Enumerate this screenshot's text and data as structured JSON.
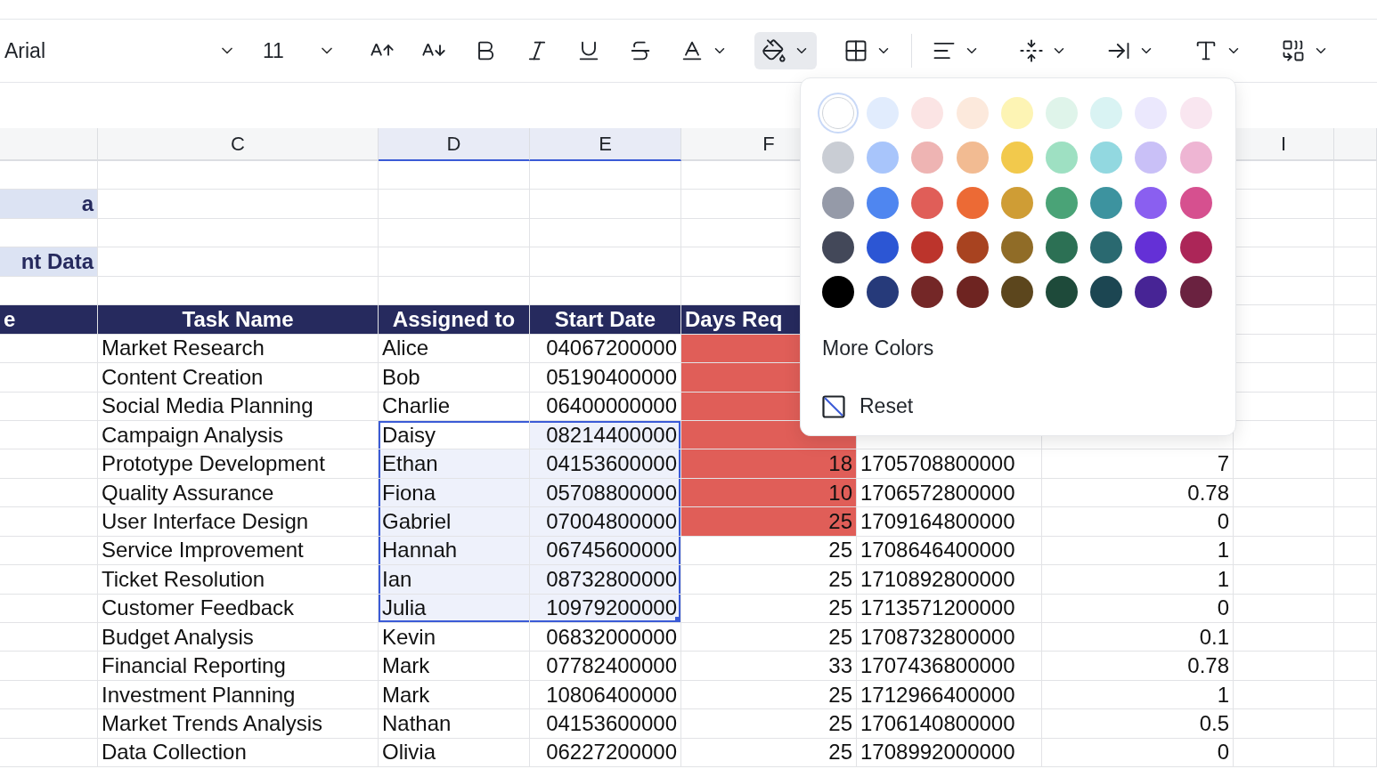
{
  "toolbar": {
    "font": "Arial",
    "font_size": "11",
    "tools": [
      {
        "selected": false
      },
      {
        "selected": false
      },
      {
        "selected": false
      },
      {
        "selected": false
      },
      {
        "selected": false
      },
      {
        "selected": false
      },
      {
        "selected": false
      },
      {
        "selected": true
      },
      {
        "selected": false
      },
      {
        "selected": false
      },
      {
        "selected": false
      },
      {
        "selected": false
      },
      {
        "selected": false
      },
      {
        "selected": false
      }
    ]
  },
  "sheet": {
    "columns": [
      {
        "selected": false
      },
      {
        "label": "C",
        "selected": false
      },
      {
        "label": "D",
        "selected": true
      },
      {
        "label": "E",
        "selected": true
      },
      {
        "label": "F",
        "selected": false
      },
      {},
      {},
      {
        "label": "I",
        "selected": false
      },
      {
        "selected": false
      }
    ],
    "rows": [
      {
        "kind": "blank",
        "selected": false,
        "cells": {}
      },
      {
        "kind": "title",
        "selected": false,
        "cells": {
          "b": "a"
        }
      },
      {
        "kind": "blank",
        "selected": false,
        "cells": {}
      },
      {
        "kind": "title",
        "selected": false,
        "cells": {
          "b": "nt Data"
        }
      },
      {
        "kind": "blank",
        "selected": false,
        "cells": {}
      },
      {
        "kind": "header",
        "selected": false,
        "cells": {
          "b": "e",
          "c": "Task Name",
          "d": "Assigned to",
          "e": "Start Date",
          "f": "Days Req"
        }
      },
      {
        "kind": "data",
        "selected": false,
        "cells": {
          "c": "Market Research",
          "d": "Alice",
          "e": "04067200000",
          "f": {
            "color": "#e05e58"
          }
        }
      },
      {
        "kind": "data",
        "selected": false,
        "cells": {
          "c": "Content Creation",
          "d": "Bob",
          "e": "05190400000",
          "f": {
            "color": "#e05e58"
          }
        }
      },
      {
        "kind": "data",
        "selected": false,
        "cells": {
          "c": "Social Media Planning",
          "d": "Charlie",
          "e": "06400000000",
          "f": {
            "color": "#e05e58"
          }
        }
      },
      {
        "kind": "data",
        "selected": true,
        "cells": {
          "c": "Campaign Analysis",
          "d": "Daisy",
          "e": "08214400000",
          "f": {
            "color": "#e05e58"
          }
        }
      },
      {
        "kind": "data",
        "selected": true,
        "cells": {
          "c": "Prototype Development",
          "d": "Ethan",
          "e": "04153600000",
          "f": {
            "text": "18",
            "color": "#e05e58"
          },
          "g": "1705708800000",
          "h": "7"
        }
      },
      {
        "kind": "data",
        "selected": true,
        "cells": {
          "c": "Quality Assurance",
          "d": "Fiona",
          "e": "05708800000",
          "f": {
            "text": "10",
            "color": "#e05e58"
          },
          "g": "1706572800000",
          "h": "0.78"
        }
      },
      {
        "kind": "data",
        "selected": true,
        "cells": {
          "c": "User Interface Design",
          "d": "Gabriel",
          "e": "07004800000",
          "f": {
            "text": "25",
            "color": "#e05e58"
          },
          "g": "1709164800000",
          "h": "0"
        }
      },
      {
        "kind": "data",
        "selected": true,
        "cells": {
          "c": "Service Improvement",
          "d": "Hannah",
          "e": "06745600000",
          "f": "25",
          "g": "1708646400000",
          "h": "1"
        }
      },
      {
        "kind": "data",
        "selected": true,
        "cells": {
          "c": "Ticket Resolution",
          "d": "Ian",
          "e": "08732800000",
          "f": "25",
          "g": "1710892800000",
          "h": "1"
        }
      },
      {
        "kind": "data",
        "selected": true,
        "cells": {
          "c": "Customer Feedback",
          "d": "Julia",
          "e": "10979200000",
          "f": "25",
          "g": "1713571200000",
          "h": "0"
        }
      },
      {
        "kind": "data",
        "selected": false,
        "cells": {
          "c": "Budget Analysis",
          "d": "Kevin",
          "e": "06832000000",
          "f": "25",
          "g": "1708732800000",
          "h": "0.1"
        }
      },
      {
        "kind": "data",
        "selected": false,
        "cells": {
          "c": "Financial Reporting",
          "d": "Mark",
          "e": "07782400000",
          "f": "33",
          "g": "1707436800000",
          "h": "0.78"
        }
      },
      {
        "kind": "data",
        "selected": false,
        "cells": {
          "c": "Investment Planning",
          "d": "Mark",
          "e": "10806400000",
          "f": "25",
          "g": "1712966400000",
          "h": "1"
        }
      },
      {
        "kind": "data",
        "selected": false,
        "cells": {
          "c": "Market Trends Analysis",
          "d": "Nathan",
          "e": "04153600000",
          "f": "25",
          "g": "1706140800000",
          "h": "0.5"
        }
      },
      {
        "kind": "data",
        "selected": false,
        "cells": {
          "c": "Data Collection",
          "d": "Olivia",
          "e": "06227200000",
          "f": "25",
          "g": "1708992000000",
          "h": "0"
        }
      }
    ]
  },
  "color_menu": {
    "palette": [
      {
        "color": "#ffffff",
        "selected": true
      },
      {
        "color": "#e1ecfd",
        "selected": false
      },
      {
        "color": "#fbe4e4",
        "selected": false
      },
      {
        "color": "#fce9dc",
        "selected": false
      },
      {
        "color": "#fdf4b4",
        "selected": false
      },
      {
        "color": "#dff4ea",
        "selected": false
      },
      {
        "color": "#d9f3f3",
        "selected": false
      },
      {
        "color": "#ebe8fd",
        "selected": false
      },
      {
        "color": "#f9e6f0",
        "selected": false
      },
      {
        "color": "#c9cdd4",
        "selected": false
      },
      {
        "color": "#a8c5fb",
        "selected": false
      },
      {
        "color": "#eeb4b3",
        "selected": false
      },
      {
        "color": "#f2bb92",
        "selected": false
      },
      {
        "color": "#f2c94c",
        "selected": false
      },
      {
        "color": "#9ee0c2",
        "selected": false
      },
      {
        "color": "#92d8e0",
        "selected": false
      },
      {
        "color": "#c9c0f7",
        "selected": false
      },
      {
        "color": "#eeb5d3",
        "selected": false
      },
      {
        "color": "#959aa8",
        "selected": false
      },
      {
        "color": "#4f86f0",
        "selected": false
      },
      {
        "color": "#e05e58",
        "selected": false
      },
      {
        "color": "#ec6a35",
        "selected": false
      },
      {
        "color": "#cf9d35",
        "selected": false
      },
      {
        "color": "#4aa377",
        "selected": false
      },
      {
        "color": "#3d939f",
        "selected": false
      },
      {
        "color": "#8a5ff0",
        "selected": false
      },
      {
        "color": "#d6508f",
        "selected": false
      },
      {
        "color": "#434859",
        "selected": false
      },
      {
        "color": "#2c56d4",
        "selected": false
      },
      {
        "color": "#bc342c",
        "selected": false
      },
      {
        "color": "#a84320",
        "selected": false
      },
      {
        "color": "#906c27",
        "selected": false
      },
      {
        "color": "#2c7054",
        "selected": false
      },
      {
        "color": "#2a6970",
        "selected": false
      },
      {
        "color": "#6430d6",
        "selected": false
      },
      {
        "color": "#ac2658",
        "selected": false
      },
      {
        "color": "#000000",
        "selected": false
      },
      {
        "color": "#263a7a",
        "selected": false
      },
      {
        "color": "#742727",
        "selected": false
      },
      {
        "color": "#6e2421",
        "selected": false
      },
      {
        "color": "#5c461d",
        "selected": false
      },
      {
        "color": "#1e4a3a",
        "selected": false
      },
      {
        "color": "#1c4652",
        "selected": false
      },
      {
        "color": "#472495",
        "selected": false
      },
      {
        "color": "#6a2240",
        "selected": false
      }
    ],
    "more_colors": "More Colors",
    "reset": "Reset"
  }
}
